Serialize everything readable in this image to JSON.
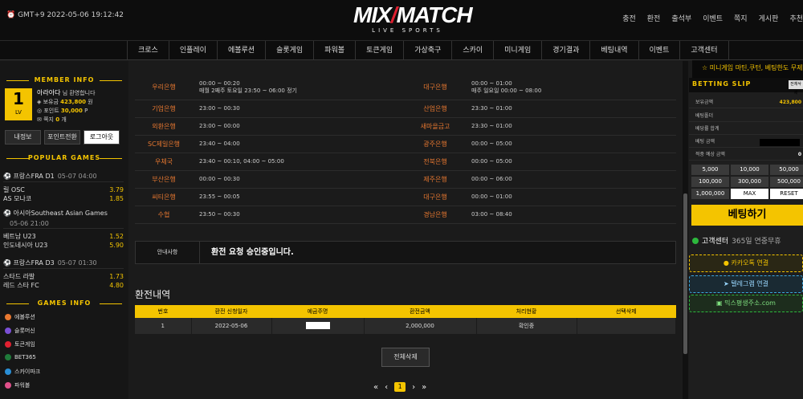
{
  "header": {
    "clock": "GMT+9 2022-05-06 19:12:42",
    "logo_main_a": "MIX",
    "logo_slash": "/",
    "logo_main_b": "MATCH",
    "logo_sub": "LIVE SPORTS",
    "top_links": [
      "충전",
      "환전",
      "출석부",
      "이벤트",
      "쪽지",
      "게시판",
      "추천"
    ]
  },
  "nav": {
    "items": [
      "크로스",
      "인플레이",
      "에볼루션",
      "슬롯게임",
      "파워볼",
      "토큰게임",
      "가상축구",
      "스카이",
      "미니게임",
      "경기결과",
      "베팅내역",
      "이벤트",
      "고객센터"
    ]
  },
  "marquee": "☆ 미니게임 마틴,쿠턴, 베팅한도 무제한",
  "member": {
    "section_title": "MEMBER INFO",
    "level": "1",
    "level_label": "LV",
    "name": "아라아다",
    "welcome": "님 환영합니다",
    "holding_label": "보유금",
    "holding": "423,800",
    "holding_unit": "원",
    "point_label": "포인트",
    "point": "30,000",
    "point_unit": "P",
    "msg_label": "쪽지",
    "msg": "0",
    "msg_unit": "개",
    "buttons": [
      "내정보",
      "포인트전환",
      "로그아웃"
    ]
  },
  "popular": {
    "section_title": "POPULAR GAMES",
    "games": [
      {
        "league": "프랑스FRA D1",
        "date": "05-07 04:00",
        "teams": [
          {
            "name": "릴 OSC",
            "odds": "3.79"
          },
          {
            "name": "AS 모나코",
            "odds": "1.85"
          }
        ]
      },
      {
        "league": "아시아Southeast Asian Games",
        "date": "05-06 21:00",
        "teams": [
          {
            "name": "베트남 U23",
            "odds": "1.52"
          },
          {
            "name": "인도네시아 U23",
            "odds": "5.90"
          }
        ]
      },
      {
        "league": "프랑스FRA D3",
        "date": "05-07 01:30",
        "teams": [
          {
            "name": "스타드 라발",
            "odds": "1.73"
          },
          {
            "name": "레드 스타 FC",
            "odds": "4.80"
          }
        ]
      }
    ]
  },
  "games_info": {
    "section_title": "GAMES INFO",
    "items": [
      {
        "label": "에볼루션",
        "color": "#e87830"
      },
      {
        "label": "슬롯머신",
        "color": "#7b4fd6"
      },
      {
        "label": "토큰게임",
        "color": "#e02030"
      },
      {
        "label": "BET365",
        "color": "#1f7a3a"
      },
      {
        "label": "스카이파크",
        "color": "#2a8fd6"
      },
      {
        "label": "파워볼",
        "color": "#e0508a"
      }
    ]
  },
  "banks": [
    {
      "l_name": "우리은행",
      "l_time": "00:00 ~ 00:20 / 매월 2째주 토요일 23:50 ~ 06:00 정기",
      "r_name": "대구은행",
      "r_time": "00:00 ~ 01:00 / 매주 일요일 00:00 ~ 08:00"
    },
    {
      "l_name": "기업은행",
      "l_time": "23:00 ~ 00:30",
      "r_name": "산업은행",
      "r_time": "23:30 ~ 01:00"
    },
    {
      "l_name": "외환은행",
      "l_time": "23:00 ~ 00:00",
      "r_name": "새마을금고",
      "r_time": "23:30 ~ 01:00"
    },
    {
      "l_name": "SC제일은행",
      "l_time": "23:40 ~ 04:00",
      "r_name": "광주은행",
      "r_time": "00:00 ~ 05:00"
    },
    {
      "l_name": "우체국",
      "l_time": "23:40 ~ 00:10, 04:00 ~ 05:00",
      "r_name": "전북은행",
      "r_time": "00:00 ~ 05:00"
    },
    {
      "l_name": "부산은행",
      "l_time": "00:00 ~ 00:30",
      "r_name": "제주은행",
      "r_time": "00:00 ~ 06:00"
    },
    {
      "l_name": "씨티은행",
      "l_time": "23:55 ~ 00:05",
      "r_name": "대구은행",
      "r_time": "00:00 ~ 01:00"
    },
    {
      "l_name": "수협",
      "l_time": "23:50 ~ 00:30",
      "r_name": "경남은행",
      "r_time": "03:00 ~ 08:40"
    }
  ],
  "notice": {
    "label": "안내사항",
    "text": "환전 요청 승인중입니다."
  },
  "history": {
    "title": "환전내역",
    "headers": [
      "번호",
      "환전 신청일자",
      "예금주명",
      "환전금액",
      "처리현황",
      "선택삭제"
    ],
    "rows": [
      {
        "no": "1",
        "date": "2022-05-06",
        "amount": "2,000,000",
        "status": "확인중"
      }
    ]
  },
  "delete_all": "전체삭제",
  "pager": {
    "first": "«",
    "prev": "‹",
    "current": "1",
    "next": "›",
    "last": "»"
  },
  "betslip": {
    "title": "BETTING SLIP",
    "clear": "전체삭제",
    "rows": [
      {
        "label": "보유금액",
        "value": "423,800"
      },
      {
        "label": "베팅폴더",
        "value": ""
      },
      {
        "label": "베당률 합계",
        "value": ""
      },
      {
        "label": "베팅 금액",
        "value": ""
      },
      {
        "label": "적중 예상 금액",
        "value": "0"
      }
    ],
    "amounts": [
      "5,000",
      "10,000",
      "50,000",
      "100,000",
      "300,000",
      "500,000",
      "1,000,000",
      "MAX",
      "RESET"
    ],
    "bet_button": "베팅하기"
  },
  "support": {
    "title": "고객센터",
    "sub": "365일 연중무휴",
    "kakao": "카카오톡 연결",
    "telegram": "텔레그램 연결",
    "site": "믹스평생주소.com"
  }
}
